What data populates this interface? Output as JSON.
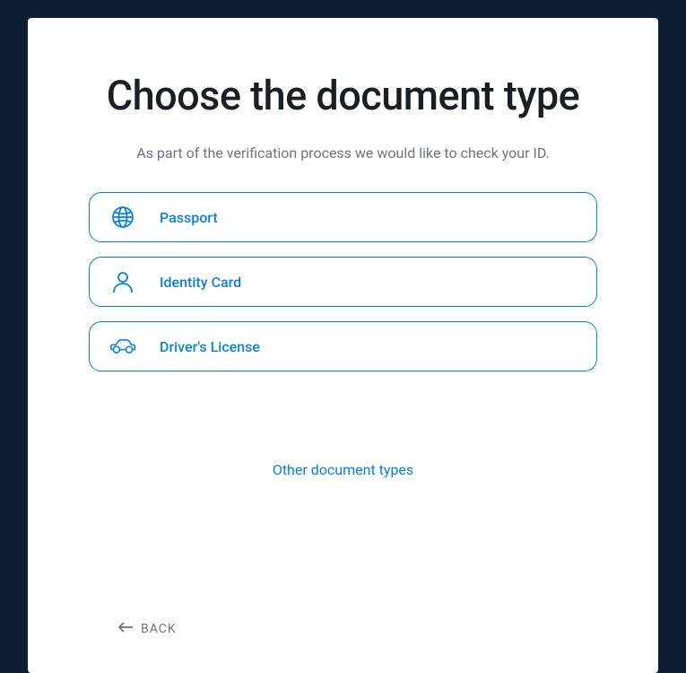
{
  "title": "Choose the document type",
  "subtitle": "As part of the verification process we would like to check your ID.",
  "options": [
    {
      "label": "Passport",
      "icon": "globe"
    },
    {
      "label": "Identity Card",
      "icon": "person"
    },
    {
      "label": "Driver's License",
      "icon": "car"
    }
  ],
  "other_link": "Other document types",
  "back_label": "BACK",
  "colors": {
    "accent": "#0c7fd8",
    "text_dark": "#1a1f24",
    "text_muted": "#6b7580",
    "background_outer": "#0b1e33",
    "background_card": "#ffffff"
  }
}
